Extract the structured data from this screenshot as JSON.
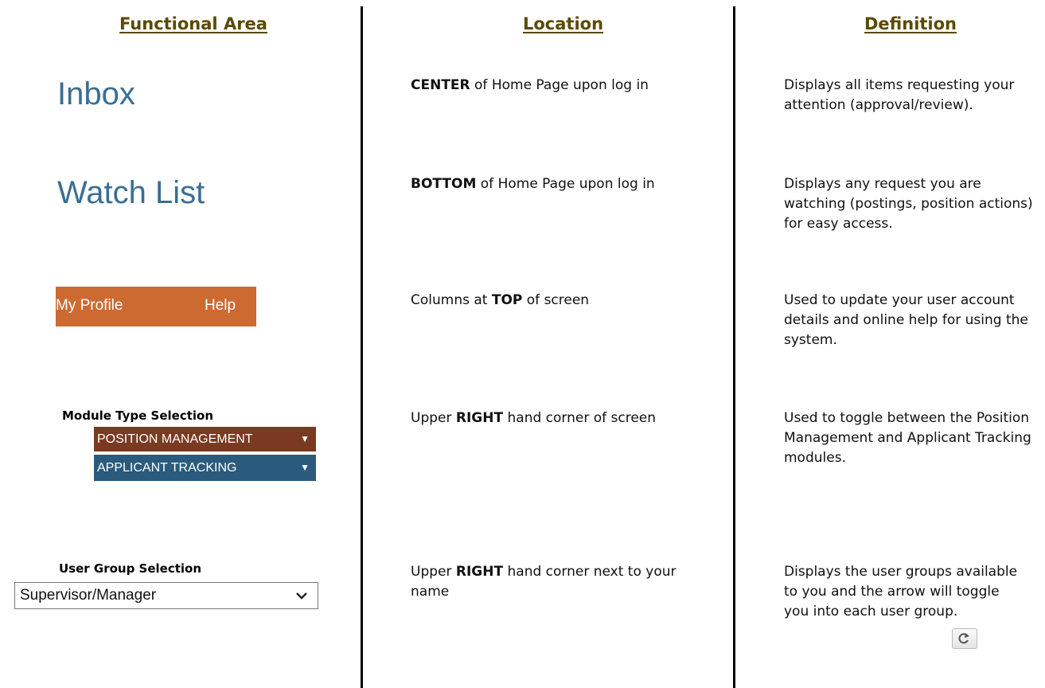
{
  "headers": {
    "functional_area": "Functional Area",
    "location": "Location",
    "definition": "Definition"
  },
  "rows": [
    {
      "area": "Inbox",
      "location_bold": "CENTER",
      "location_rest": " of Home Page upon log in",
      "definition": "Displays all items requesting your attention (approval/review)."
    },
    {
      "area": "Watch List",
      "location_bold": "BOTTOM",
      "location_rest": " of Home Page upon log in",
      "definition": "Displays any request you are watching (postings, position actions) for easy access."
    },
    {
      "area_nav": {
        "my_profile": "My Profile",
        "help": "Help"
      },
      "location_prefix": "Columns at ",
      "location_bold": "TOP",
      "location_rest": " of screen",
      "definition": "Used to update your user account details and online help for using the system."
    },
    {
      "area_label": "Module Type Selection",
      "modules": [
        {
          "label": "POSITION MANAGEMENT",
          "arrow": "▼",
          "color": "#7a3a22"
        },
        {
          "label": "APPLICANT TRACKING",
          "arrow": "▼",
          "color": "#2a5b7c"
        }
      ],
      "location_prefix": "Upper ",
      "location_bold": "RIGHT",
      "location_rest": " hand corner of screen",
      "definition": "Used to toggle between the Position Management and Applicant Tracking modules."
    },
    {
      "area_label": "User Group Selection",
      "select_value": "Supervisor/Manager",
      "location_prefix": "Upper ",
      "location_bold": "RIGHT",
      "location_rest": " hand corner next to your name",
      "definition": "Displays the user groups available to you and the arrow will toggle you into each user group.",
      "icon": "refresh-icon"
    }
  ]
}
